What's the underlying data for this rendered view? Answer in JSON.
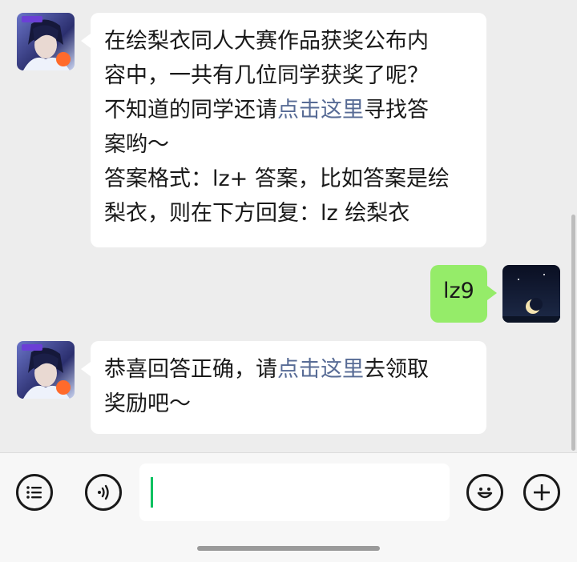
{
  "messages": [
    {
      "sender": "official-account",
      "avatar_icon": "game-character-avatar-icon",
      "lines_before_link": [
        "在绘梨衣同人大赛作品获奖公布内",
        "容中，一共有几位同学获奖了呢？",
        "不知道的同学还请"
      ],
      "link": "点击这里",
      "after_link": "寻找答",
      "lines_after": [
        "案哟～",
        "答案格式：lz+ 答案，比如答案是绘",
        "梨衣，则在下方回复：lz 绘梨衣"
      ]
    },
    {
      "sender": "me",
      "avatar_icon": "moon-night-avatar-icon",
      "text": "lz9"
    },
    {
      "sender": "official-account",
      "avatar_icon": "game-character-avatar-icon",
      "before_link": "恭喜回答正确，请",
      "link": "点击这里",
      "after_link": "去领取",
      "line2": "奖励吧～"
    }
  ],
  "input_bar": {
    "left_icon": "list-menu-icon",
    "voice_icon": "voice-icon",
    "input_value": "",
    "emoji_icon": "emoji-icon",
    "more_icon": "plus-icon"
  },
  "colors": {
    "background": "#ededed",
    "bubble_other": "#ffffff",
    "bubble_me": "#95ec69",
    "link": "#576b95",
    "caret": "#07c160"
  }
}
